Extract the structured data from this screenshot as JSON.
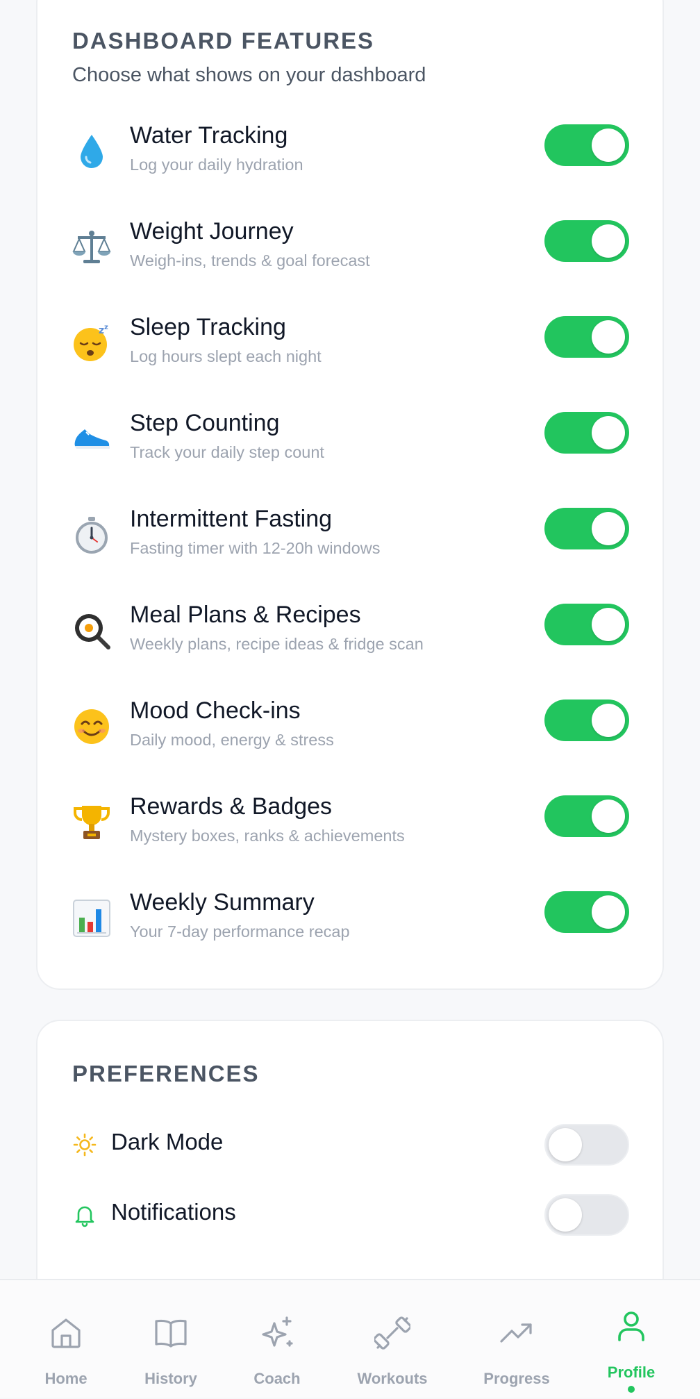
{
  "features": {
    "title": "DASHBOARD FEATURES",
    "subtitle": "Choose what shows on your dashboard",
    "items": [
      {
        "icon": "water-drop-icon",
        "title": "Water Tracking",
        "desc": "Log your daily hydration",
        "enabled": true
      },
      {
        "icon": "balance-scale-icon",
        "title": "Weight Journey",
        "desc": "Weigh-ins, trends & goal forecast",
        "enabled": true
      },
      {
        "icon": "sleeping-face-icon",
        "title": "Sleep Tracking",
        "desc": "Log hours slept each night",
        "enabled": true
      },
      {
        "icon": "sneaker-icon",
        "title": "Step Counting",
        "desc": "Track your daily step count",
        "enabled": true
      },
      {
        "icon": "stopwatch-icon",
        "title": "Intermittent Fasting",
        "desc": "Fasting timer with 12-20h windows",
        "enabled": true
      },
      {
        "icon": "frying-pan-egg-icon",
        "title": "Meal Plans & Recipes",
        "desc": "Weekly plans, recipe ideas & fridge scan",
        "enabled": true
      },
      {
        "icon": "smiling-face-icon",
        "title": "Mood Check-ins",
        "desc": "Daily mood, energy & stress",
        "enabled": true
      },
      {
        "icon": "trophy-icon",
        "title": "Rewards & Badges",
        "desc": "Mystery boxes, ranks & achievements",
        "enabled": true
      },
      {
        "icon": "bar-chart-icon",
        "title": "Weekly Summary",
        "desc": "Your 7-day performance recap",
        "enabled": true
      }
    ]
  },
  "preferences": {
    "title": "PREFERENCES",
    "items": [
      {
        "icon": "sun-icon",
        "label": "Dark Mode",
        "enabled": false
      },
      {
        "icon": "bell-icon",
        "label": "Notifications",
        "enabled": false
      }
    ]
  },
  "nav": {
    "items": [
      {
        "icon": "home-icon",
        "label": "Home"
      },
      {
        "icon": "book-icon",
        "label": "History"
      },
      {
        "icon": "sparkle-icon",
        "label": "Coach"
      },
      {
        "icon": "dumbbell-icon",
        "label": "Workouts"
      },
      {
        "icon": "trending-up-icon",
        "label": "Progress"
      },
      {
        "icon": "user-icon",
        "label": "Profile",
        "active": true
      }
    ]
  },
  "colors": {
    "accent": "#22c55e",
    "toggle_off": "#e5e7eb",
    "background": "#f7f8fa",
    "muted_text": "#9ca3af"
  }
}
